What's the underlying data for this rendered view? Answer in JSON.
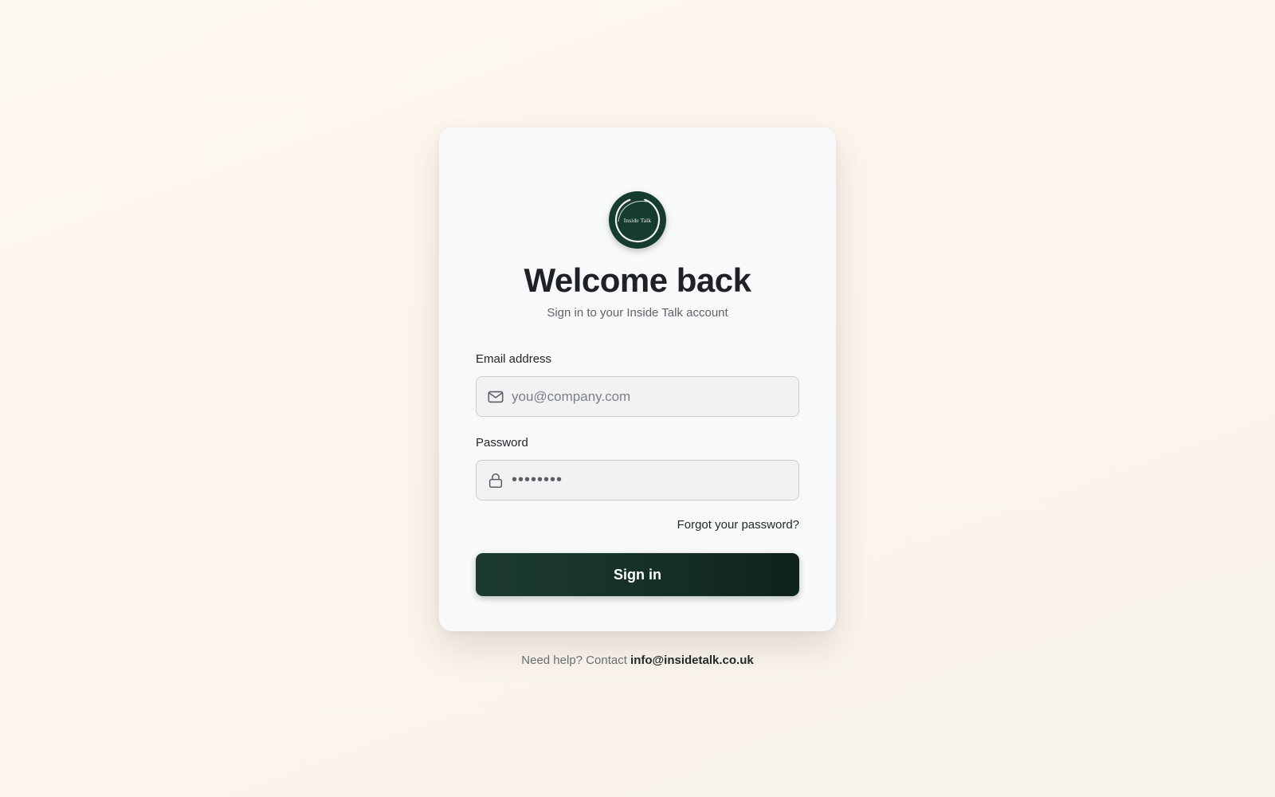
{
  "logo": {
    "text": "Inside Talk",
    "color": "#163b30"
  },
  "heading": {
    "title": "Welcome back",
    "subtitle": "Sign in to your Inside Talk account"
  },
  "form": {
    "email": {
      "label": "Email address",
      "placeholder": "you@company.com",
      "value": "",
      "icon": "mail-icon"
    },
    "password": {
      "label": "Password",
      "value": "••••••••",
      "icon": "lock-icon"
    },
    "forgot_link": "Forgot your password?",
    "submit_label": "Sign in"
  },
  "footer": {
    "help_text": "Need help? Contact",
    "email": "info@insidetalk.co.uk"
  },
  "colors": {
    "brand": "#163b30",
    "button_start": "#1d3a31",
    "button_end": "#0f221d",
    "background": "#fdf8f1"
  }
}
